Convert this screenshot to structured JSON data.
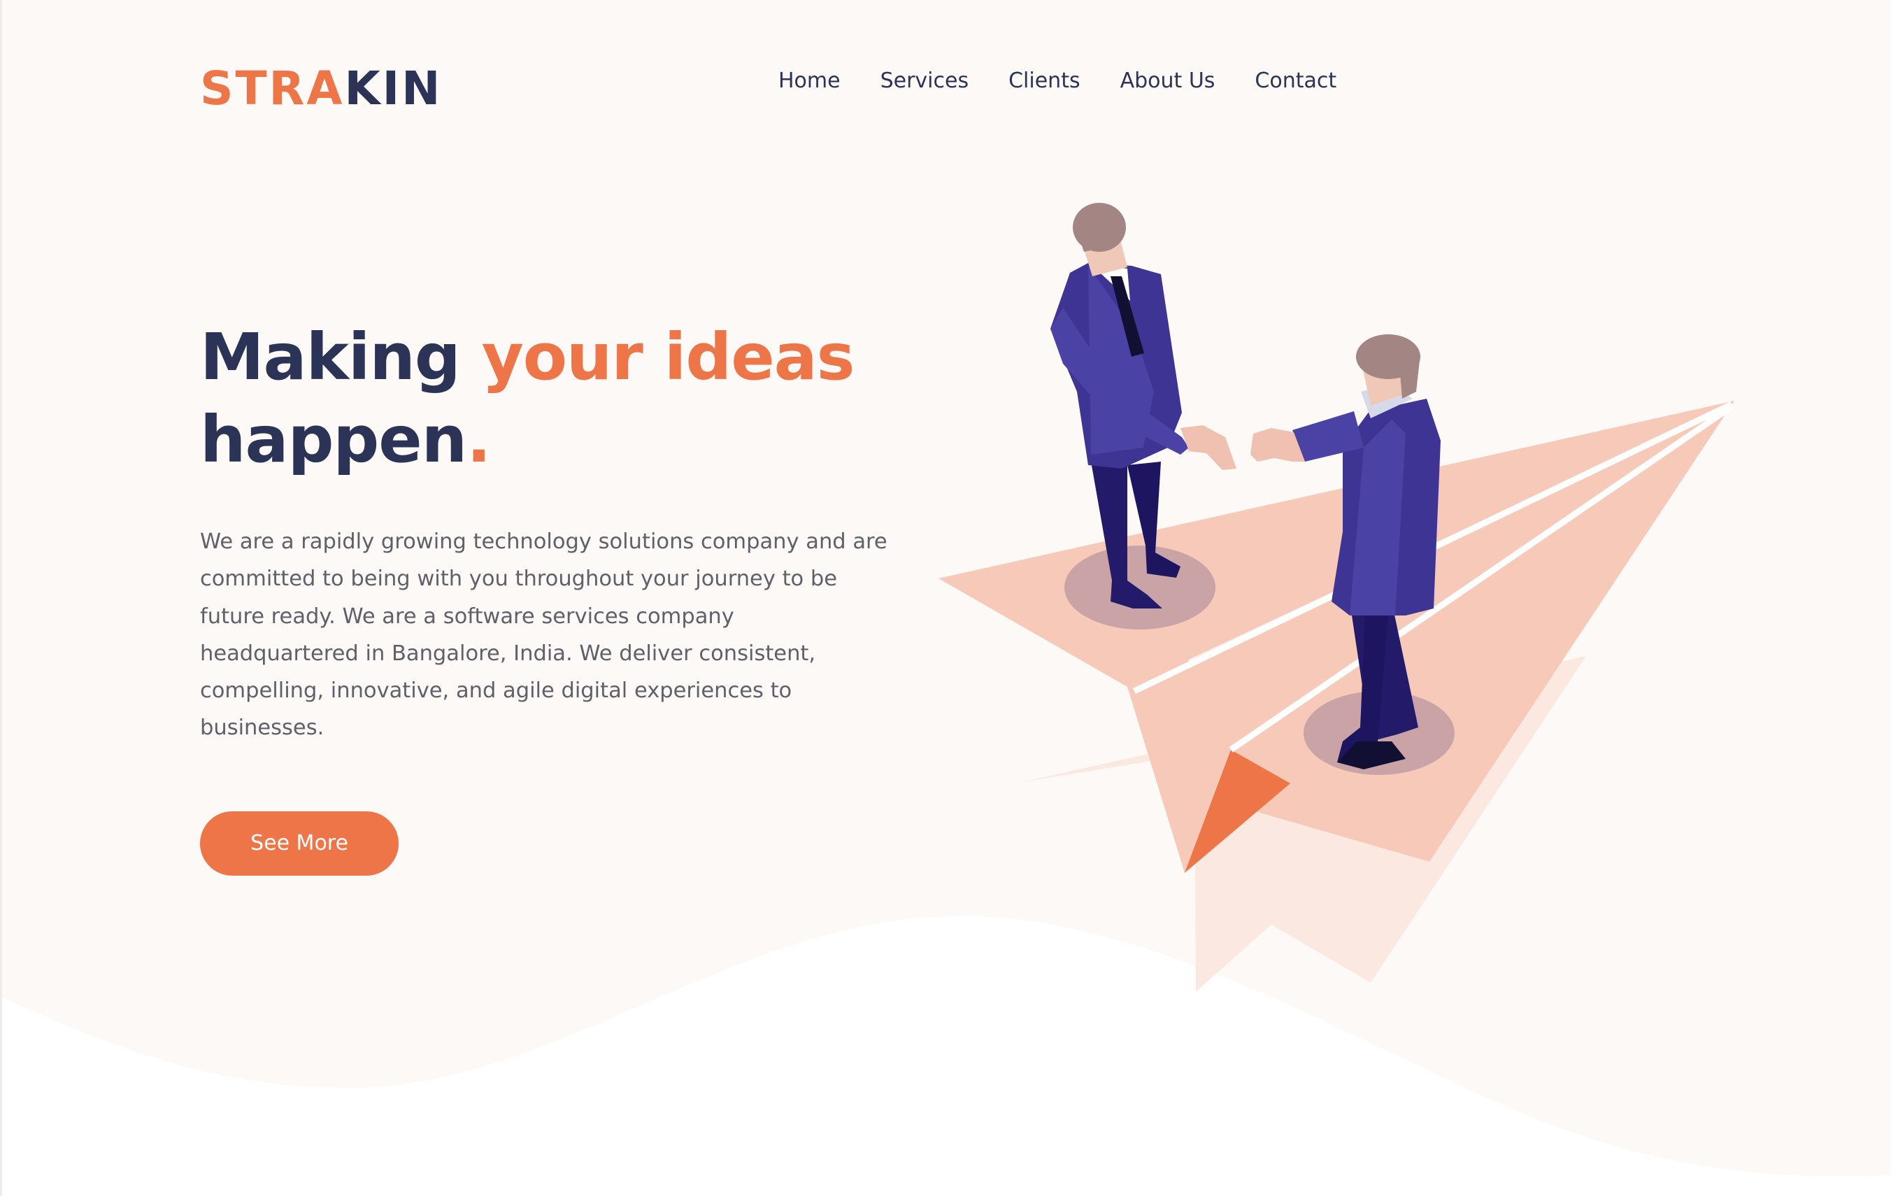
{
  "brand": {
    "logo_part1": "STRA",
    "logo_part2": "KIN",
    "accent_color": "#ee7547",
    "primary_color": "#2b3457"
  },
  "nav": {
    "items": [
      {
        "label": "Home"
      },
      {
        "label": "Services"
      },
      {
        "label": "Clients"
      },
      {
        "label": "About Us"
      },
      {
        "label": "Contact"
      }
    ]
  },
  "hero": {
    "headline_part1": "Making ",
    "headline_accent": "your ideas",
    "headline_part2": "happen",
    "headline_dot": ".",
    "description": "We are a rapidly growing technology solutions company and are committed to being with you throughout your journey to be future ready. We are a software services company headquartered in Bangalore, India. We deliver consistent, compelling, innovative, and agile digital experiences to businesses.",
    "cta_label": "See More"
  },
  "illustration": {
    "icon": "paper-plane-handshake-illustration"
  }
}
